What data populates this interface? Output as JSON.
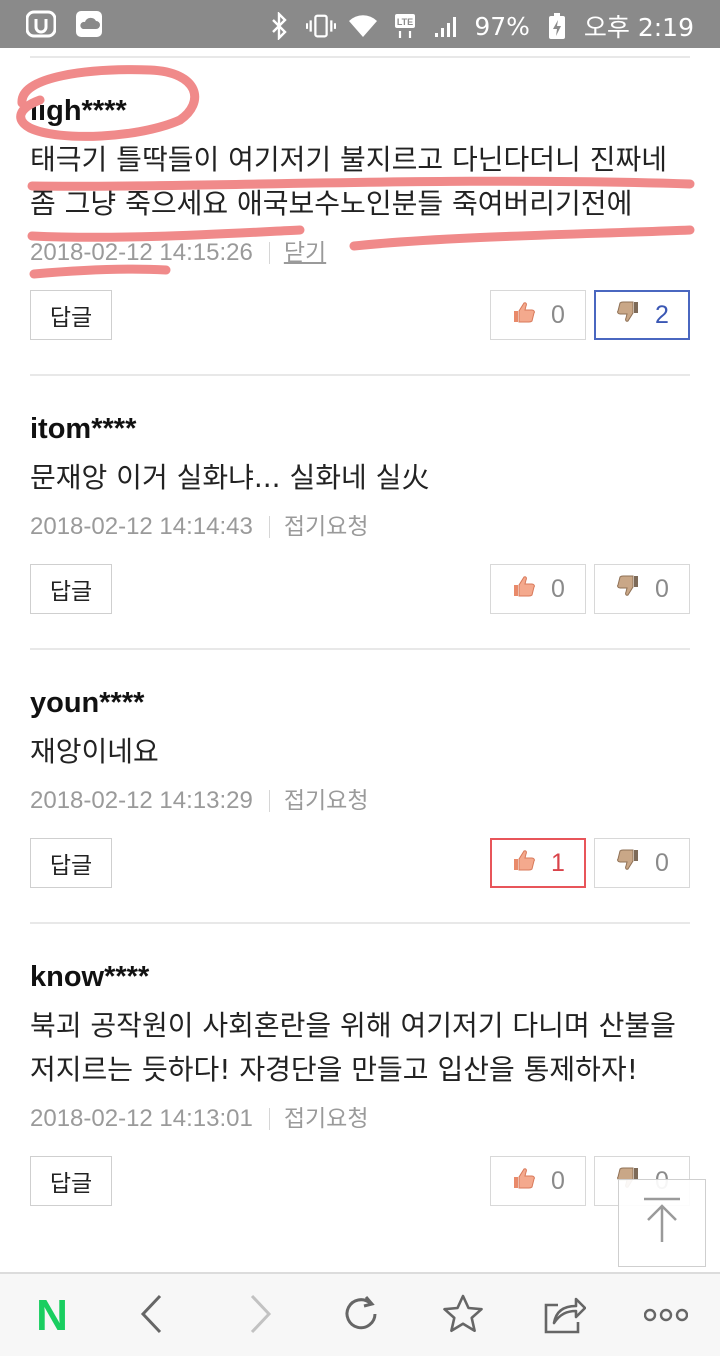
{
  "status_bar": {
    "battery": "97%",
    "time": "오후 2:19",
    "network": "LTE"
  },
  "comments": [
    {
      "author": "ligh****",
      "text": "태극기 틀딱들이 여기저기 불지르고 다닌다더니 진짜네 좀 그냥 죽으세요 애국보수노인분들 죽여버리기전에",
      "timestamp": "2018-02-12 14:15:26",
      "action": "닫기",
      "reply_label": "답글",
      "likes": "0",
      "dislikes": "2",
      "highlight": "dislike"
    },
    {
      "author": "itom****",
      "text": "문재앙 이거 실화냐... 실화네 실火",
      "timestamp": "2018-02-12 14:14:43",
      "action": "접기요청",
      "reply_label": "답글",
      "likes": "0",
      "dislikes": "0",
      "highlight": "none"
    },
    {
      "author": "youn****",
      "text": "재앙이네요",
      "timestamp": "2018-02-12 14:13:29",
      "action": "접기요청",
      "reply_label": "답글",
      "likes": "1",
      "dislikes": "0",
      "highlight": "like"
    },
    {
      "author": "know****",
      "text": "북괴 공작원이 사회혼란을 위해 여기저기 다니며 산불을 저지르는 듯하다! 자경단을 만들고 입산을 통제하자!",
      "timestamp": "2018-02-12 14:13:01",
      "action": "접기요청",
      "reply_label": "답글",
      "likes": "0",
      "dislikes": "0",
      "highlight": "none"
    }
  ],
  "bottom_nav": {
    "logo": "N",
    "icons": [
      "naver-logo",
      "back-icon",
      "forward-icon",
      "refresh-icon",
      "star-icon",
      "share-icon",
      "more-icon"
    ]
  },
  "colors": {
    "status_bar": "#8a8a8a",
    "naver_green": "#19ce60",
    "like_active": "#e8555a",
    "dislike_active": "#4a67c0",
    "annotation": "#f08a8a"
  }
}
